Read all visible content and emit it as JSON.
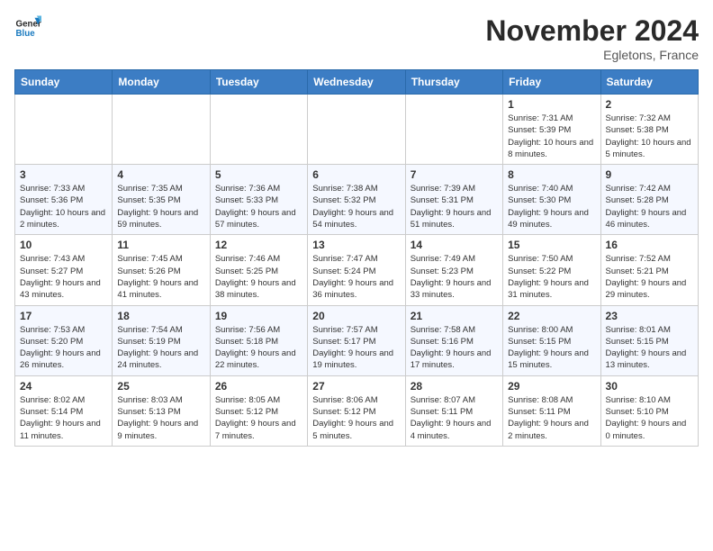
{
  "header": {
    "logo_line1": "General",
    "logo_line2": "Blue",
    "month_title": "November 2024",
    "location": "Egletons, France"
  },
  "weekdays": [
    "Sunday",
    "Monday",
    "Tuesday",
    "Wednesday",
    "Thursday",
    "Friday",
    "Saturday"
  ],
  "weeks": [
    [
      {
        "day": "",
        "info": ""
      },
      {
        "day": "",
        "info": ""
      },
      {
        "day": "",
        "info": ""
      },
      {
        "day": "",
        "info": ""
      },
      {
        "day": "",
        "info": ""
      },
      {
        "day": "1",
        "info": "Sunrise: 7:31 AM\nSunset: 5:39 PM\nDaylight: 10 hours and 8 minutes."
      },
      {
        "day": "2",
        "info": "Sunrise: 7:32 AM\nSunset: 5:38 PM\nDaylight: 10 hours and 5 minutes."
      }
    ],
    [
      {
        "day": "3",
        "info": "Sunrise: 7:33 AM\nSunset: 5:36 PM\nDaylight: 10 hours and 2 minutes."
      },
      {
        "day": "4",
        "info": "Sunrise: 7:35 AM\nSunset: 5:35 PM\nDaylight: 9 hours and 59 minutes."
      },
      {
        "day": "5",
        "info": "Sunrise: 7:36 AM\nSunset: 5:33 PM\nDaylight: 9 hours and 57 minutes."
      },
      {
        "day": "6",
        "info": "Sunrise: 7:38 AM\nSunset: 5:32 PM\nDaylight: 9 hours and 54 minutes."
      },
      {
        "day": "7",
        "info": "Sunrise: 7:39 AM\nSunset: 5:31 PM\nDaylight: 9 hours and 51 minutes."
      },
      {
        "day": "8",
        "info": "Sunrise: 7:40 AM\nSunset: 5:30 PM\nDaylight: 9 hours and 49 minutes."
      },
      {
        "day": "9",
        "info": "Sunrise: 7:42 AM\nSunset: 5:28 PM\nDaylight: 9 hours and 46 minutes."
      }
    ],
    [
      {
        "day": "10",
        "info": "Sunrise: 7:43 AM\nSunset: 5:27 PM\nDaylight: 9 hours and 43 minutes."
      },
      {
        "day": "11",
        "info": "Sunrise: 7:45 AM\nSunset: 5:26 PM\nDaylight: 9 hours and 41 minutes."
      },
      {
        "day": "12",
        "info": "Sunrise: 7:46 AM\nSunset: 5:25 PM\nDaylight: 9 hours and 38 minutes."
      },
      {
        "day": "13",
        "info": "Sunrise: 7:47 AM\nSunset: 5:24 PM\nDaylight: 9 hours and 36 minutes."
      },
      {
        "day": "14",
        "info": "Sunrise: 7:49 AM\nSunset: 5:23 PM\nDaylight: 9 hours and 33 minutes."
      },
      {
        "day": "15",
        "info": "Sunrise: 7:50 AM\nSunset: 5:22 PM\nDaylight: 9 hours and 31 minutes."
      },
      {
        "day": "16",
        "info": "Sunrise: 7:52 AM\nSunset: 5:21 PM\nDaylight: 9 hours and 29 minutes."
      }
    ],
    [
      {
        "day": "17",
        "info": "Sunrise: 7:53 AM\nSunset: 5:20 PM\nDaylight: 9 hours and 26 minutes."
      },
      {
        "day": "18",
        "info": "Sunrise: 7:54 AM\nSunset: 5:19 PM\nDaylight: 9 hours and 24 minutes."
      },
      {
        "day": "19",
        "info": "Sunrise: 7:56 AM\nSunset: 5:18 PM\nDaylight: 9 hours and 22 minutes."
      },
      {
        "day": "20",
        "info": "Sunrise: 7:57 AM\nSunset: 5:17 PM\nDaylight: 9 hours and 19 minutes."
      },
      {
        "day": "21",
        "info": "Sunrise: 7:58 AM\nSunset: 5:16 PM\nDaylight: 9 hours and 17 minutes."
      },
      {
        "day": "22",
        "info": "Sunrise: 8:00 AM\nSunset: 5:15 PM\nDaylight: 9 hours and 15 minutes."
      },
      {
        "day": "23",
        "info": "Sunrise: 8:01 AM\nSunset: 5:15 PM\nDaylight: 9 hours and 13 minutes."
      }
    ],
    [
      {
        "day": "24",
        "info": "Sunrise: 8:02 AM\nSunset: 5:14 PM\nDaylight: 9 hours and 11 minutes."
      },
      {
        "day": "25",
        "info": "Sunrise: 8:03 AM\nSunset: 5:13 PM\nDaylight: 9 hours and 9 minutes."
      },
      {
        "day": "26",
        "info": "Sunrise: 8:05 AM\nSunset: 5:12 PM\nDaylight: 9 hours and 7 minutes."
      },
      {
        "day": "27",
        "info": "Sunrise: 8:06 AM\nSunset: 5:12 PM\nDaylight: 9 hours and 5 minutes."
      },
      {
        "day": "28",
        "info": "Sunrise: 8:07 AM\nSunset: 5:11 PM\nDaylight: 9 hours and 4 minutes."
      },
      {
        "day": "29",
        "info": "Sunrise: 8:08 AM\nSunset: 5:11 PM\nDaylight: 9 hours and 2 minutes."
      },
      {
        "day": "30",
        "info": "Sunrise: 8:10 AM\nSunset: 5:10 PM\nDaylight: 9 hours and 0 minutes."
      }
    ]
  ]
}
